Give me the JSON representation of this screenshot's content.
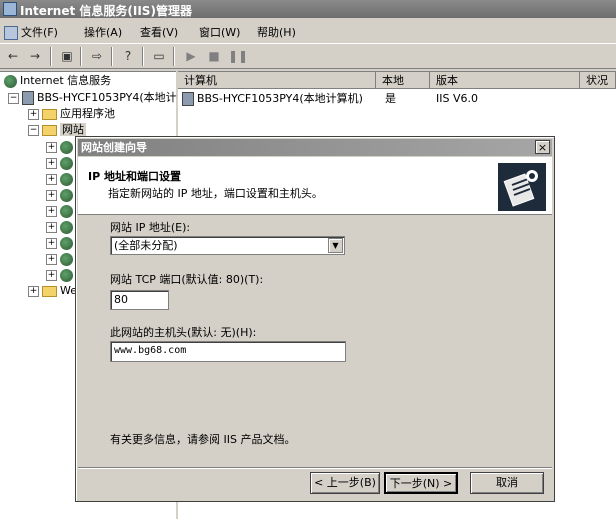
{
  "window": {
    "title": "Internet 信息服务(IIS)管理器"
  },
  "menu": [
    {
      "label": "文件(F)"
    },
    {
      "label": "操作(A)"
    },
    {
      "label": "查看(V)"
    },
    {
      "label": "窗口(W)"
    },
    {
      "label": "帮助(H)"
    }
  ],
  "toolbar": {
    "icons": [
      "back-icon",
      "forward-icon",
      "console-icon",
      "export-icon",
      "help-icon",
      "computer-icon",
      "play-icon",
      "stop-icon",
      "pause-icon"
    ]
  },
  "tree": {
    "root": "Internet 信息服务",
    "server": "BBS-HYCF1053PY4(本地计",
    "app_pools": "应用程序池",
    "websites": "网站",
    "web_ext": "We"
  },
  "list": {
    "columns": [
      "计算机",
      "本地",
      "版本",
      "状况"
    ],
    "rows": [
      {
        "computer": "BBS-HYCF1053PY4(本地计算机)",
        "local": "是",
        "version": "IIS V6.0",
        "status": ""
      }
    ]
  },
  "dialog": {
    "title": "网站创建向导",
    "close_label": "×",
    "header_title": "IP 地址和端口设置",
    "header_subtitle": "指定新网站的 IP 地址，端口设置和主机头。",
    "ip_label": "网站 IP 地址(E):",
    "ip_value": "(全部未分配)",
    "port_label": "网站 TCP 端口(默认值: 80)(T):",
    "port_value": "80",
    "host_label": "此网站的主机头(默认: 无)(H):",
    "host_value": "www.bg68.com",
    "info_text": "有关更多信息，请参阅 IIS 产品文档。",
    "back_button": "< 上一步(B)",
    "next_button": "下一步(N) >",
    "cancel_button": "取消"
  }
}
